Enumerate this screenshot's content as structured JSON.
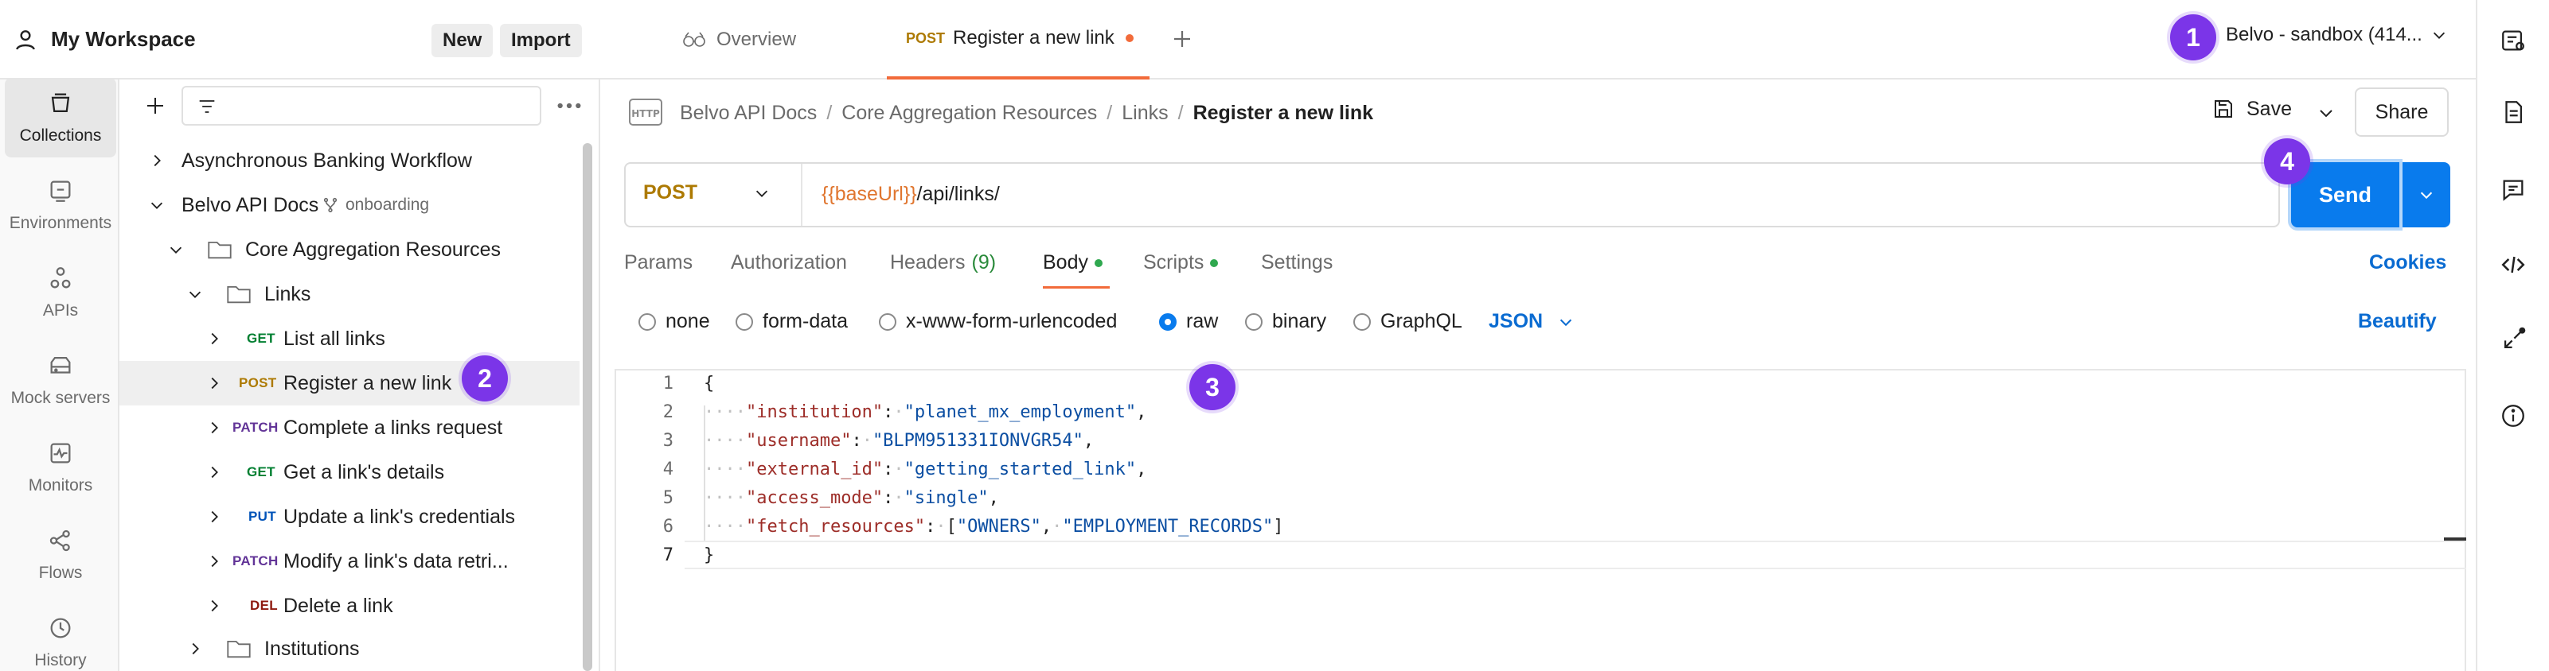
{
  "workspace": {
    "title": "My Workspace",
    "new_label": "New",
    "import_label": "Import"
  },
  "rail": [
    {
      "label": "Collections",
      "icon": "collections-icon",
      "active": true
    },
    {
      "label": "Environments",
      "icon": "environments-icon"
    },
    {
      "label": "APIs",
      "icon": "apis-icon"
    },
    {
      "label": "Mock servers",
      "icon": "mock-servers-icon"
    },
    {
      "label": "Monitors",
      "icon": "monitors-icon"
    },
    {
      "label": "Flows",
      "icon": "flows-icon"
    },
    {
      "label": "History",
      "icon": "history-icon"
    }
  ],
  "tree": {
    "async": "Asynchronous Banking Workflow",
    "belvo": "Belvo API Docs",
    "belvo_fork": "onboarding",
    "core": "Core Aggregation Resources",
    "links": "Links",
    "items": [
      {
        "method": "GET",
        "label": "List all links"
      },
      {
        "method": "POST",
        "label": "Register a new link"
      },
      {
        "method": "PATCH",
        "label": "Complete a links request"
      },
      {
        "method": "GET",
        "label": "Get a link's details"
      },
      {
        "method": "PUT",
        "label": "Update a link's credentials"
      },
      {
        "method": "PATCH",
        "label": "Modify a link's data retri..."
      },
      {
        "method": "DEL",
        "label": "Delete a link"
      }
    ],
    "institutions": "Institutions"
  },
  "tabs": {
    "overview": "Overview",
    "active_method": "POST",
    "active_label": "Register a new link"
  },
  "environment": "Belvo - sandbox (414...",
  "breadcrumb": {
    "parts": [
      "Belvo API Docs",
      "Core Aggregation Resources",
      "Links"
    ],
    "current": "Register a new link"
  },
  "actions": {
    "save": "Save",
    "share": "Share",
    "send": "Send"
  },
  "request": {
    "method": "POST",
    "url_var": "{{baseUrl}}",
    "url_path": "/api/links/"
  },
  "req_tabs": {
    "params": "Params",
    "authorization": "Authorization",
    "headers": "Headers",
    "headers_count": "(9)",
    "body": "Body",
    "scripts": "Scripts",
    "settings": "Settings",
    "cookies": "Cookies"
  },
  "body_types": {
    "none": "none",
    "form_data": "form-data",
    "urlencoded": "x-www-form-urlencoded",
    "raw": "raw",
    "binary": "binary",
    "graphql": "GraphQL",
    "format": "JSON",
    "beautify": "Beautify",
    "selected": "raw"
  },
  "code": {
    "line_numbers": [
      "1",
      "2",
      "3",
      "4",
      "5",
      "6",
      "7"
    ],
    "open": "{",
    "close": "}",
    "fields": [
      {
        "key": "\"institution\"",
        "value": "\"planet_mx_employment\""
      },
      {
        "key": "\"username\"",
        "value": "\"BLPM951331IONVGR54\""
      },
      {
        "key": "\"external_id\"",
        "value": "\"getting_started_link\""
      },
      {
        "key": "\"access_mode\"",
        "value": "\"single\""
      },
      {
        "key": "\"fetch_resources\"",
        "value_a": "\"OWNERS\"",
        "value_b": "\"EMPLOYMENT_RECORDS\""
      }
    ]
  },
  "badges": [
    "1",
    "2",
    "3",
    "4"
  ],
  "colors": {
    "accent": "#f26b3a",
    "send": "#097bed",
    "badge": "#7b35e8"
  }
}
